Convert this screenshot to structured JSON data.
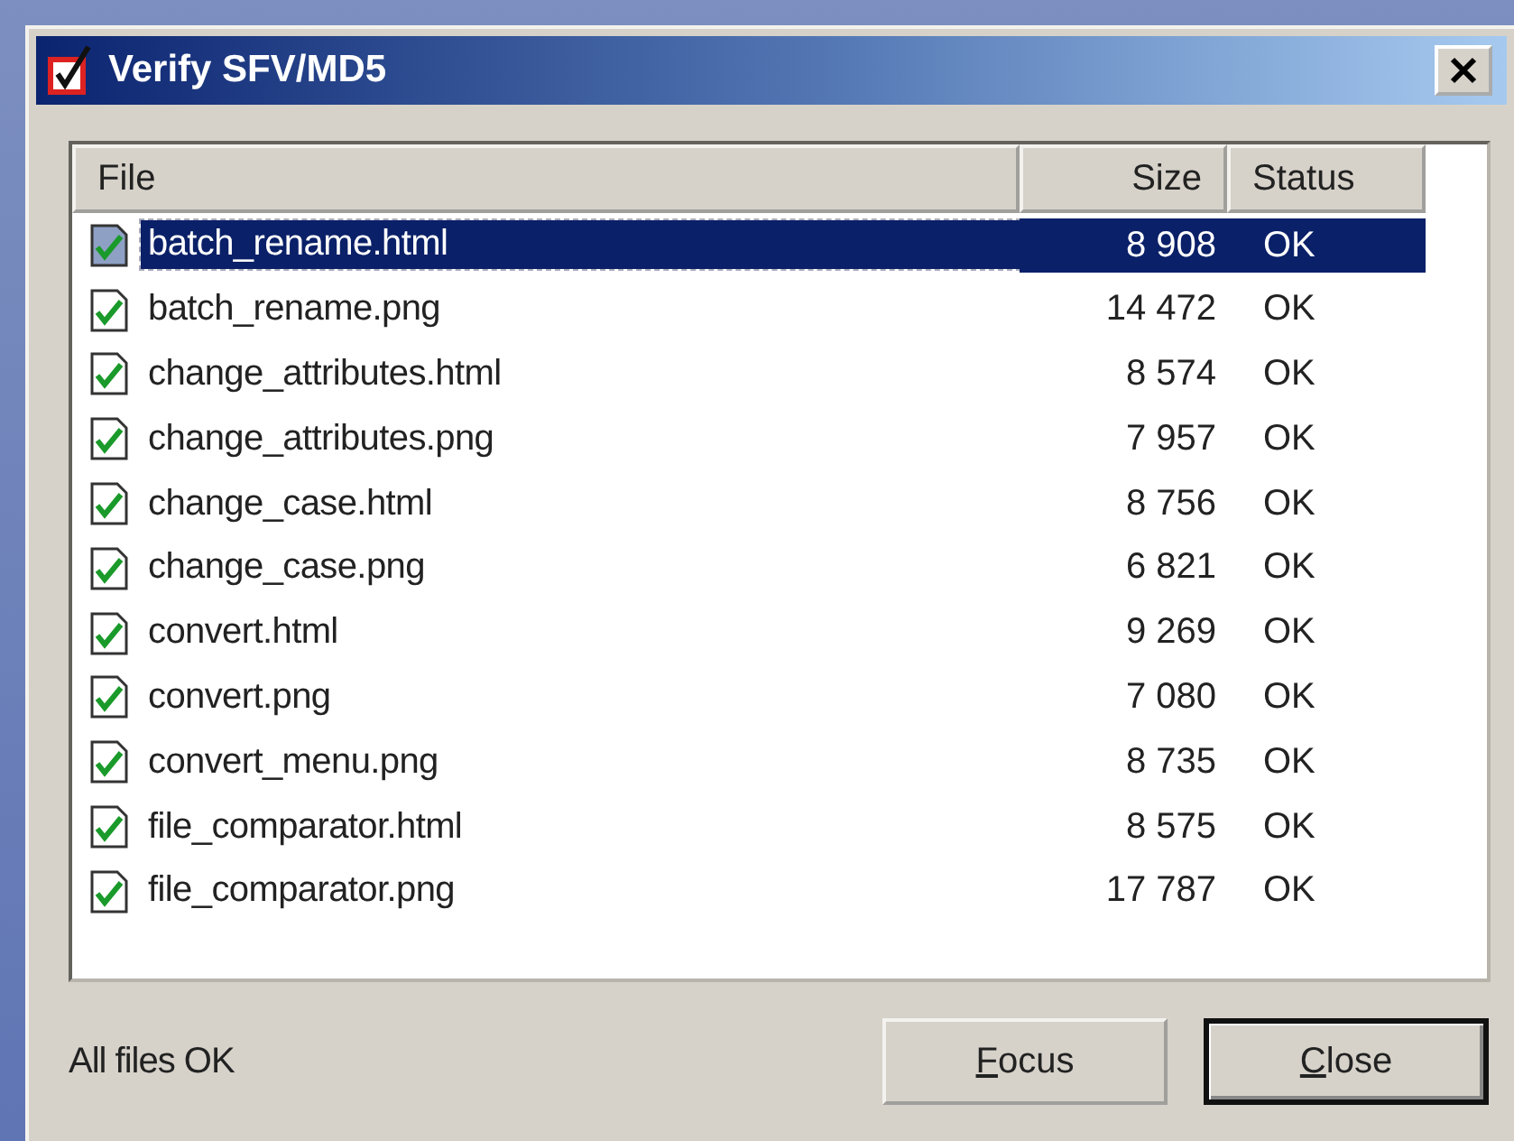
{
  "window": {
    "title": "Verify SFV/MD5"
  },
  "table": {
    "columns": [
      "File",
      "Size",
      "Status"
    ],
    "rows": [
      {
        "file": "batch_rename.html",
        "size": "8 908",
        "status": "OK",
        "checked": true,
        "selected": true
      },
      {
        "file": "batch_rename.png",
        "size": "14 472",
        "status": "OK",
        "checked": true,
        "selected": false
      },
      {
        "file": "change_attributes.html",
        "size": "8 574",
        "status": "OK",
        "checked": true,
        "selected": false
      },
      {
        "file": "change_attributes.png",
        "size": "7 957",
        "status": "OK",
        "checked": true,
        "selected": false
      },
      {
        "file": "change_case.html",
        "size": "8 756",
        "status": "OK",
        "checked": true,
        "selected": false
      },
      {
        "file": "change_case.png",
        "size": "6 821",
        "status": "OK",
        "checked": true,
        "selected": false
      },
      {
        "file": "convert.html",
        "size": "9 269",
        "status": "OK",
        "checked": true,
        "selected": false
      },
      {
        "file": "convert.png",
        "size": "7 080",
        "status": "OK",
        "checked": true,
        "selected": false
      },
      {
        "file": "convert_menu.png",
        "size": "8 735",
        "status": "OK",
        "checked": true,
        "selected": false
      },
      {
        "file": "file_comparator.html",
        "size": "8 575",
        "status": "OK",
        "checked": true,
        "selected": false
      },
      {
        "file": "file_comparator.png",
        "size": "17 787",
        "status": "OK",
        "checked": true,
        "selected": false
      }
    ]
  },
  "status_text": "All files OK",
  "buttons": [
    {
      "label": "Focus",
      "underline_first": true,
      "default": false
    },
    {
      "label": "Close",
      "underline_first": true,
      "default": true
    }
  ]
}
